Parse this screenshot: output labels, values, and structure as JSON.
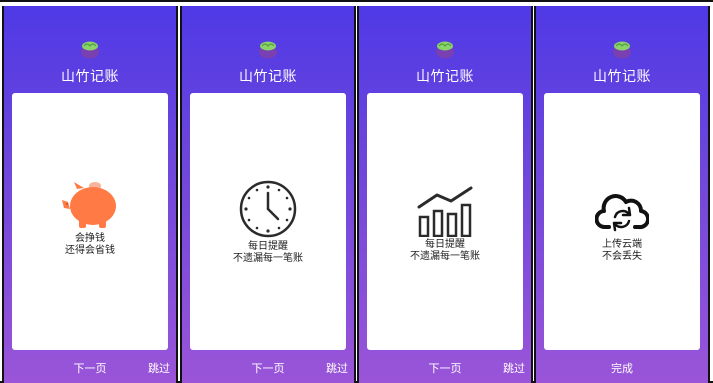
{
  "app_title": "山竹记账",
  "panels": [
    {
      "caption_line1": "会挣钱",
      "caption_line2": "还得会省钱",
      "next_label": "下一页",
      "skip_label": "跳过",
      "icon": "piggy-bank-icon"
    },
    {
      "caption_line1": "每日提醒",
      "caption_line2": "不遗漏每一笔账",
      "next_label": "下一页",
      "skip_label": "跳过",
      "icon": "clock-icon"
    },
    {
      "caption_line1": "每日提醒",
      "caption_line2": "不遗漏每一笔账",
      "next_label": "下一页",
      "skip_label": "跳过",
      "icon": "growth-chart-icon"
    },
    {
      "caption_line1": "上传云端",
      "caption_line2": "不会丢失",
      "done_label": "完成",
      "icon": "cloud-sync-icon"
    }
  ],
  "colors": {
    "gradient_top": "#4f39e6",
    "gradient_bottom": "#9a55d8",
    "piggy": "#ff7a45",
    "icon_dark": "#2b2b2b",
    "logo_green": "#8ad26a",
    "logo_purple": "#7a3fb0"
  }
}
